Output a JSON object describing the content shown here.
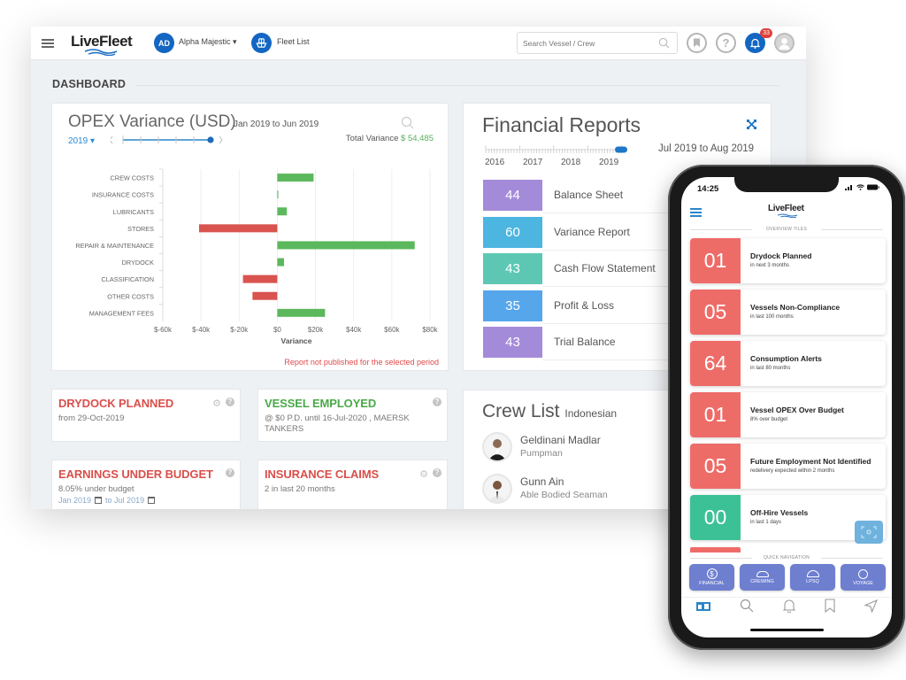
{
  "app": {
    "logo": "LiveFleet",
    "user_initials": "AD",
    "vessel": "Alpha Majestic",
    "fleet_link": "Fleet List",
    "search_placeholder": "Search Vessel / Crew",
    "notification_count": "33",
    "icons": [
      "menu-icon",
      "ship-icon",
      "search-icon",
      "bookmark-icon",
      "help-icon",
      "bell-icon",
      "user-avatar-icon"
    ]
  },
  "dashboard": {
    "title": "DASHBOARD",
    "opex": {
      "title": "OPEX Variance (USD)",
      "range": "Jan 2019 to Jun 2019",
      "year": "2019",
      "total_label": "Total Variance",
      "total_value": "$ 54,485",
      "note": "Report not published for the selected period"
    },
    "financial_reports": {
      "title": "Financial Reports",
      "timeline_years": [
        "2016",
        "2017",
        "2018",
        "2019"
      ],
      "range": "Jul 2019 to Aug 2019",
      "items": [
        {
          "count": "44",
          "label": "Balance Sheet",
          "color": "#a48bd9"
        },
        {
          "count": "60",
          "label": "Variance Report",
          "color": "#4cb5e0"
        },
        {
          "count": "43",
          "label": "Cash Flow Statement",
          "color": "#5dc7b4"
        },
        {
          "count": "35",
          "label": "Profit & Loss",
          "color": "#56a6ec"
        },
        {
          "count": "43",
          "label": "Trial Balance",
          "color": "#a48bd9"
        }
      ]
    },
    "tiles": {
      "drydock": {
        "title": "DRYDOCK PLANNED",
        "sub": "from 29-Oct-2019"
      },
      "vessel_employed": {
        "title": "VESSEL EMPLOYED",
        "sub": "@ $0 P.D. until 16-Jul-2020 , MAERSK TANKERS"
      },
      "earnings": {
        "title": "EARNINGS UNDER BUDGET",
        "sub": "8.05% under budget",
        "from": "Jan 2019",
        "to": "to Jul 2019"
      },
      "insurance": {
        "title": "INSURANCE CLAIMS",
        "sub": "2 in last 20 months"
      }
    },
    "crew_list": {
      "title": "Crew List",
      "nationality": "Indonesian",
      "members": [
        {
          "name": "Geldinani Madlar",
          "role": "Pumpman"
        },
        {
          "name": "Gunn Ain",
          "role": "Able Bodied Seaman"
        }
      ]
    }
  },
  "chart_data": {
    "type": "bar",
    "orientation": "horizontal",
    "title": "OPEX Variance (USD)",
    "xlabel": "Variance",
    "ylabel": "",
    "categories": [
      "CREW COSTS",
      "INSURANCE COSTS",
      "LUBRICANTS",
      "STORES",
      "REPAIR & MAINTENANCE",
      "DRYDOCK",
      "CLASSIFICATION",
      "OTHER COSTS",
      "MANAGEMENT FEES"
    ],
    "values": [
      19000,
      500,
      5000,
      -41000,
      72000,
      3500,
      -18000,
      -13000,
      25000
    ],
    "xlim": [
      -60000,
      80000
    ],
    "x_ticks": [
      "$-60k",
      "$-40k",
      "$-20k",
      "$0",
      "$20k",
      "$40k",
      "$60k",
      "$80k"
    ],
    "x_tick_values": [
      -60000,
      -40000,
      -20000,
      0,
      20000,
      40000,
      60000,
      80000
    ],
    "positive_color": "#5cb85c",
    "negative_color": "#d9534f",
    "grid": true
  },
  "mobile": {
    "time": "14:25",
    "logo": "LiveFleet",
    "overview_label": "OVERVIEW TILES",
    "tiles": [
      {
        "count": "01",
        "title": "Drydock Planned",
        "sub": "in next 3 months",
        "color": "#ee6c68"
      },
      {
        "count": "05",
        "title": "Vessels Non-Compliance",
        "sub": "in last 100 months",
        "color": "#ee6c68"
      },
      {
        "count": "64",
        "title": "Consumption Alerts",
        "sub": "in last 80 months",
        "color": "#ee6c68"
      },
      {
        "count": "01",
        "title": "Vessel OPEX Over Budget",
        "sub": "8% over budget",
        "color": "#ee6c68"
      },
      {
        "count": "05",
        "title": "Future Employment Not Identified",
        "sub": "redelivery expected within 2 months",
        "color": "#ee6c68"
      },
      {
        "count": "00",
        "title": "Off-Hire Vessels",
        "sub": "in last 1 days",
        "color": "#3cc196"
      }
    ],
    "quick_nav_label": "QUICK NAVIGATION",
    "quick_nav": [
      "FINANCIAL",
      "CREWING",
      "LPSQ",
      "VOYAGE"
    ],
    "tabbar": [
      "dashboard-tab",
      "search-tab",
      "notifications-tab",
      "bookmarks-tab",
      "navigate-tab"
    ]
  }
}
